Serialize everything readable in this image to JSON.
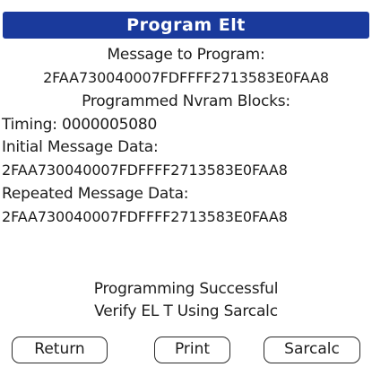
{
  "dialog": {
    "title": "Program Elt",
    "message_to_program_label": "Message to Program:",
    "message_to_program_value": "2FAA730040007FDFFFF2713583E0FAA8",
    "programmed_blocks_label": "Programmed Nvram Blocks:",
    "timing": "Timing: 0000005080",
    "initial_label": "Initial Message Data:",
    "initial_value": "2FAA730040007FDFFFF2713583E0FAA8",
    "repeated_label": "Repeated Message Data:",
    "repeated_value": "2FAA730040007FDFFFF2713583E0FAA8",
    "status_line1": "Programming Successful",
    "status_line2": "Verify EL T Using Sarcalc"
  },
  "buttons": {
    "return_label": "Return",
    "print_label": "Print",
    "sarcalc_label": "Sarcalc"
  },
  "colors": {
    "title_bar": "#1a3a9c",
    "title_text": "#ffffff",
    "background": "#ffffff",
    "text": "#1c1c1c"
  }
}
